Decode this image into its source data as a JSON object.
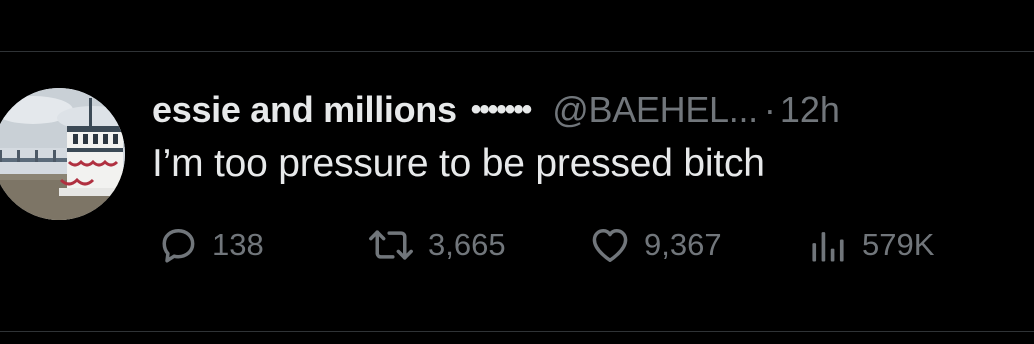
{
  "tweet": {
    "display_name": "essie and millions",
    "name_decoration": "•••••••",
    "handle": "@BAEHEL...",
    "separator": "·",
    "time": "12h",
    "text": "I’m too pressure to be pressed bitch"
  },
  "actions": {
    "reply": {
      "icon": "reply-icon",
      "count": "138"
    },
    "retweet": {
      "icon": "retweet-icon",
      "count": "3,665"
    },
    "like": {
      "icon": "heart-icon",
      "count": "9,367"
    },
    "views": {
      "icon": "views-icon",
      "count": "579K"
    }
  },
  "colors": {
    "background": "#000000",
    "primary_text": "#e7e9ea",
    "secondary_text": "#71767b",
    "divider": "#2f3336"
  }
}
